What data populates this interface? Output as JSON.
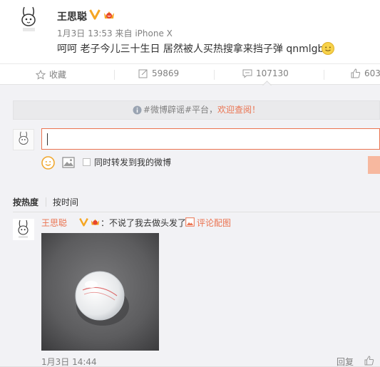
{
  "post": {
    "username": "王思聪",
    "verified_badge": "v-verified-icon",
    "member_badge": "crown-member-icon",
    "timestamp": "1月3日 13:53",
    "source_prefix": "来自",
    "source": "iPhone X",
    "text": "呵呵 老子今儿三十生日 居然被人买热搜拿来挡子弹 qnmlgb",
    "trailing_emoji": "smiley-emoji"
  },
  "actions": {
    "favorite_label": "收藏",
    "repost_count": "59869",
    "comment_count": "107130",
    "like_count": "603"
  },
  "comments": {
    "rumor_banner": {
      "text": "#微博辟谣#平台，",
      "link": "欢迎查阅！"
    },
    "input": {
      "value": ""
    },
    "forward_label": "同时转发到我的微博",
    "sort": {
      "hot": "按热度",
      "time": "按时间"
    },
    "items": [
      {
        "username": "王思聪",
        "text": "：不说了我去做头发了",
        "pic_link": "评论配图",
        "time": "1月3日 14:44",
        "reply_label": "回复"
      }
    ]
  },
  "colors": {
    "accent": "#eb7350",
    "badge_gold": "#f5a623",
    "muted_text": "#808080",
    "background": "#f2f2f5"
  }
}
